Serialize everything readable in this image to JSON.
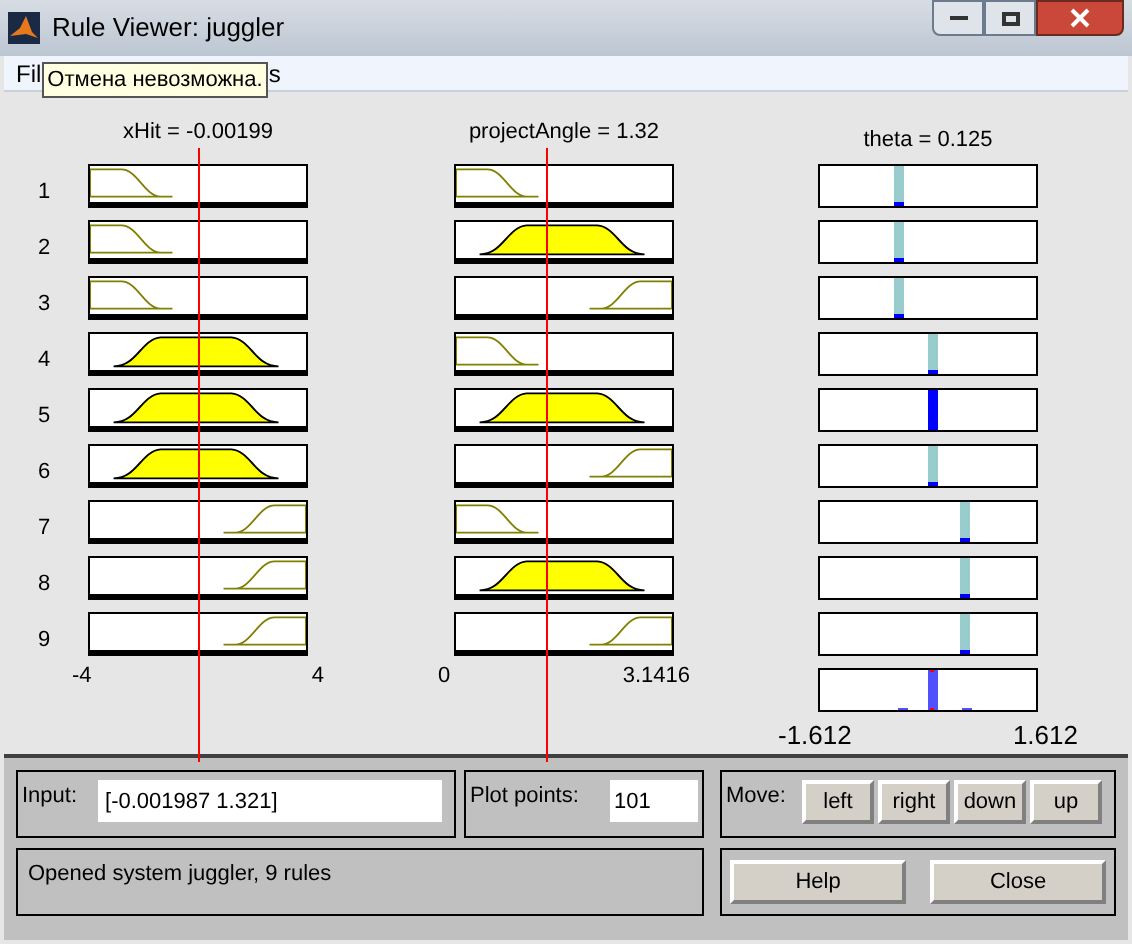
{
  "window": {
    "title": "Rule Viewer: juggler"
  },
  "menu_bar": {
    "items": [
      "Fil",
      "s"
    ]
  },
  "tooltip": {
    "text": "Отмена невозможна."
  },
  "rule_numbers": [
    "1",
    "2",
    "3",
    "4",
    "5",
    "6",
    "7",
    "8",
    "9"
  ],
  "inputs": [
    {
      "label": "xHit = -0.00199",
      "axis_min": "-4",
      "axis_max": "4",
      "rules": [
        {
          "kind": "z",
          "fired": false
        },
        {
          "kind": "z",
          "fired": false
        },
        {
          "kind": "z",
          "fired": false
        },
        {
          "kind": "trap",
          "fired": true
        },
        {
          "kind": "trap",
          "fired": true
        },
        {
          "kind": "trap",
          "fired": true
        },
        {
          "kind": "s",
          "fired": false
        },
        {
          "kind": "s",
          "fired": false
        },
        {
          "kind": "s",
          "fired": false
        }
      ]
    },
    {
      "label": "projectAngle = 1.32",
      "axis_min": "0",
      "axis_max": "3.1416",
      "rules": [
        {
          "kind": "z",
          "fired": false
        },
        {
          "kind": "trap",
          "fired": true
        },
        {
          "kind": "s",
          "fired": false
        },
        {
          "kind": "z",
          "fired": false
        },
        {
          "kind": "trap",
          "fired": true
        },
        {
          "kind": "s",
          "fired": false
        },
        {
          "kind": "z",
          "fired": false
        },
        {
          "kind": "trap",
          "fired": true
        },
        {
          "kind": "s",
          "fired": false
        }
      ]
    }
  ],
  "output": {
    "label": "theta = 0.125",
    "axis_min": "-1.612",
    "axis_max": "1.612",
    "rules": [
      {
        "kind": "left",
        "fired": false
      },
      {
        "kind": "left",
        "fired": false
      },
      {
        "kind": "left",
        "fired": false
      },
      {
        "kind": "center",
        "fired": false
      },
      {
        "kind": "center",
        "fired": true
      },
      {
        "kind": "center",
        "fired": false
      },
      {
        "kind": "right",
        "fired": false
      },
      {
        "kind": "right",
        "fired": false
      },
      {
        "kind": "right",
        "fired": false
      }
    ]
  },
  "input_field": {
    "label": "Input:",
    "value": "[-0.001987 1.321]"
  },
  "plot_points": {
    "label": "Plot points:",
    "value": "101"
  },
  "move": {
    "label": "Move:",
    "buttons": [
      "left",
      "right",
      "down",
      "up"
    ]
  },
  "status": "Opened system juggler, 9 rules",
  "buttons": [
    "Help",
    "Close"
  ]
}
